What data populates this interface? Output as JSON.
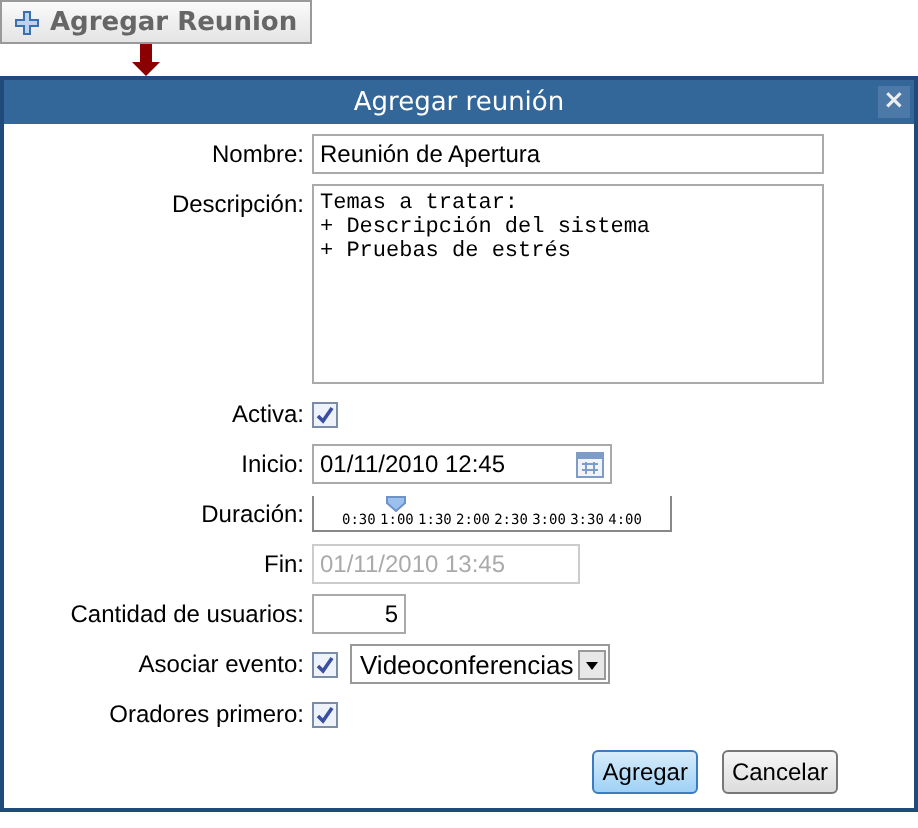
{
  "launcher_button": {
    "label": "Agregar Reunion"
  },
  "dialog": {
    "title": "Agregar reunión",
    "close": "×"
  },
  "fields": [
    {
      "kind": "text",
      "label": "Nombre:",
      "value": "Reunión de Apertura"
    },
    {
      "kind": "textarea",
      "label": "Descripción:",
      "value": "Temas a tratar:\n+ Descripción del sistema\n+ Pruebas de estrés"
    },
    {
      "kind": "checkbox",
      "label": "Activa:",
      "checked": true
    },
    {
      "kind": "date",
      "label": "Inicio:",
      "value": "01/11/2010 12:45"
    },
    {
      "kind": "slider",
      "label": "Duración:",
      "level": 0.23,
      "ticks": [
        "0:30",
        "1:00",
        "1:30",
        "2:00",
        "2:30",
        "3:00",
        "3:30",
        "4:00"
      ]
    },
    {
      "kind": "text",
      "label": "Fin:",
      "value": "01/11/2010 13:45",
      "disabled": true
    },
    {
      "kind": "number",
      "label": "Cantidad de usuarios:",
      "value": "5"
    },
    {
      "kind": "checkselect",
      "label": "Asociar evento:",
      "checked": true,
      "value": "Videoconferencias"
    },
    {
      "kind": "checkbox",
      "label": "Oradores primero:",
      "checked": true
    }
  ],
  "buttons": [
    {
      "label": "Agregar",
      "primary": true
    },
    {
      "label": "Cancelar",
      "primary": false
    }
  ]
}
